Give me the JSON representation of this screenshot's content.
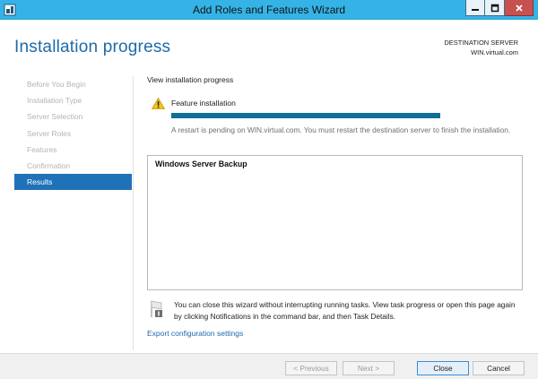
{
  "window": {
    "title": "Add Roles and Features Wizard",
    "controls": [
      "minimize",
      "maximize",
      "close"
    ]
  },
  "header": {
    "page_title": "Installation progress",
    "destination_label": "DESTINATION SERVER",
    "destination_server": "WIN.virtual.com"
  },
  "nav": {
    "items": [
      {
        "label": "Before You Begin",
        "active": false
      },
      {
        "label": "Installation Type",
        "active": false
      },
      {
        "label": "Server Selection",
        "active": false
      },
      {
        "label": "Server Roles",
        "active": false
      },
      {
        "label": "Features",
        "active": false
      },
      {
        "label": "Confirmation",
        "active": false
      },
      {
        "label": "Results",
        "active": true
      }
    ]
  },
  "main": {
    "view_label": "View installation progress",
    "feature_label": "Feature installation",
    "progress": 1.0,
    "restart_message": "A restart is pending on WIN.virtual.com. You must restart the destination server to finish the installation.",
    "results_items": [
      "Windows Server Backup"
    ],
    "note": "You can close this wizard without interrupting running tasks. View task progress or open this page again by clicking Notifications in the command bar, and then Task Details.",
    "export_link": "Export configuration settings"
  },
  "footer": {
    "previous": "< Previous",
    "next": "Next >",
    "close": "Close",
    "cancel": "Cancel"
  },
  "colors": {
    "titlebar": "#35b3e6",
    "accent": "#1e6aa8",
    "nav_active": "#2072b8",
    "progress": "#0f6f95",
    "link": "#1f68ad"
  }
}
